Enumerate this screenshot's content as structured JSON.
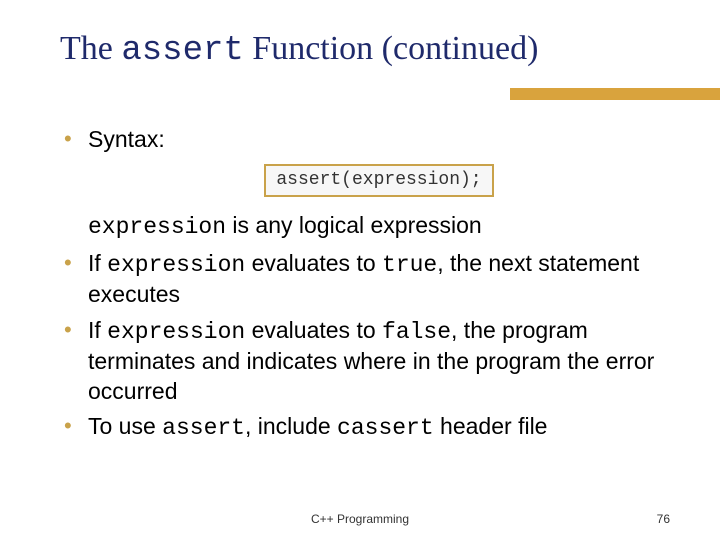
{
  "title": {
    "pre": "The ",
    "code": "assert",
    "post": " Function (continued)"
  },
  "codebox": "assert(expression);",
  "bullets": {
    "b1": "Syntax:",
    "sub_pre": "expression",
    "sub_post": " is any logical expression",
    "b2_pre": "If ",
    "b2_code1": "expression",
    "b2_mid": " evaluates to ",
    "b2_code2": "true",
    "b2_post": ", the next statement executes",
    "b3_pre": "If ",
    "b3_code1": "expression",
    "b3_mid": " evaluates to ",
    "b3_code2": "false",
    "b3_post": ", the program terminates and indicates where in the program the error occurred",
    "b4_pre": "To use ",
    "b4_code1": "assert",
    "b4_mid": ", include ",
    "b4_code2": "cassert",
    "b4_post": " header file"
  },
  "footer": "C++ Programming",
  "page": "76"
}
